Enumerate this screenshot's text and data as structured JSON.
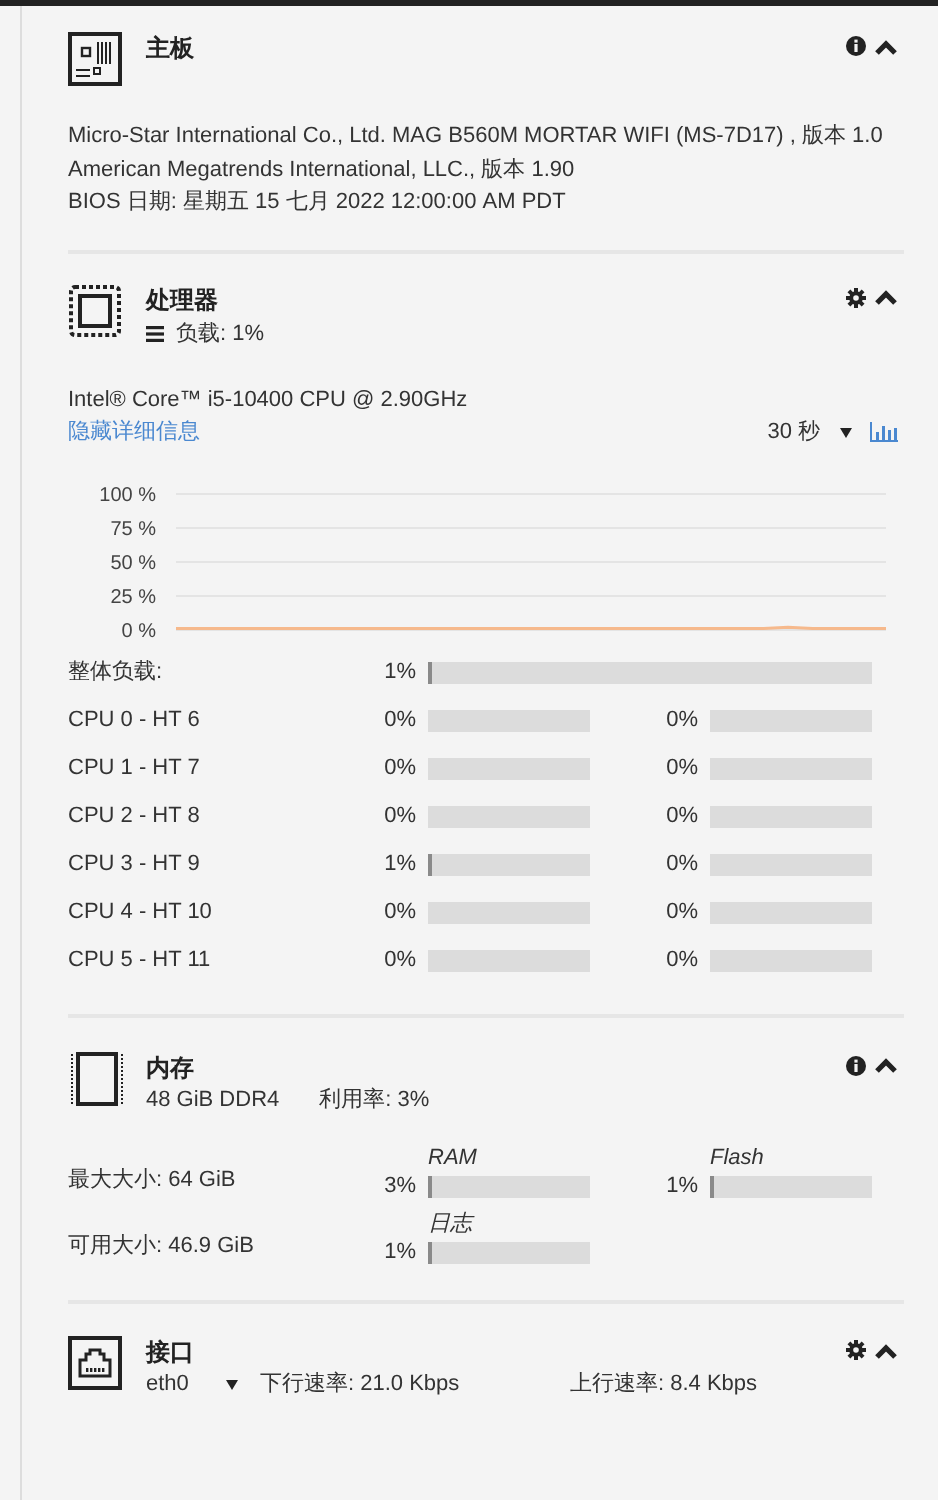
{
  "motherboard": {
    "title": "主板",
    "lines": [
      "Micro-Star International Co., Ltd. MAG B560M MORTAR WIFI (MS-7D17) , 版本 1.0",
      "American Megatrends International, LLC., 版本 1.90",
      "BIOS 日期: 星期五 15 七月 2022 12:00:00 AM PDT"
    ]
  },
  "processor": {
    "title": "处理器",
    "load": "负载: 1%",
    "model": "Intel® Core™ i5-10400 CPU @ 2.90GHz",
    "details_link": "隐藏详细信息",
    "interval": "30 秒",
    "chart_data": {
      "type": "line",
      "ylim": [
        0,
        100
      ],
      "yticks": [
        {
          "value": 100,
          "label": "100 %"
        },
        {
          "value": 75,
          "label": "75 %"
        },
        {
          "value": 50,
          "label": "50 %"
        },
        {
          "value": 25,
          "label": "25 %"
        },
        {
          "value": 0,
          "label": "0 %"
        }
      ],
      "grid": true,
      "series": [
        {
          "color": "#f6b98c",
          "values": [
            1,
            1,
            1,
            1,
            1,
            1,
            1,
            1,
            1,
            1,
            1,
            1,
            1,
            1,
            1,
            1,
            1,
            1,
            1,
            1,
            1,
            1,
            1,
            1,
            1,
            2,
            1,
            1,
            1,
            1
          ]
        }
      ]
    },
    "overall": {
      "label": "整体负载:",
      "reading": "1%",
      "level": 0.01
    },
    "cores": [
      {
        "label": "CPU 0 - HT 6",
        "bars": [
          {
            "reading": "0%",
            "level": 0
          },
          {
            "reading": "0%",
            "level": 0
          }
        ]
      },
      {
        "label": "CPU 1 - HT 7",
        "bars": [
          {
            "reading": "0%",
            "level": 0
          },
          {
            "reading": "0%",
            "level": 0
          }
        ]
      },
      {
        "label": "CPU 2 - HT 8",
        "bars": [
          {
            "reading": "0%",
            "level": 0
          },
          {
            "reading": "0%",
            "level": 0
          }
        ]
      },
      {
        "label": "CPU 3 - HT 9",
        "bars": [
          {
            "reading": "1%",
            "level": 0.01
          },
          {
            "reading": "0%",
            "level": 0
          }
        ]
      },
      {
        "label": "CPU 4 - HT 10",
        "bars": [
          {
            "reading": "0%",
            "level": 0
          },
          {
            "reading": "0%",
            "level": 0
          }
        ]
      },
      {
        "label": "CPU 5 - HT 11",
        "bars": [
          {
            "reading": "0%",
            "level": 0
          },
          {
            "reading": "0%",
            "level": 0
          }
        ]
      }
    ]
  },
  "memory": {
    "title": "内存",
    "size": "48 GiB DDR4",
    "usage": "利用率: 3%",
    "rows": [
      {
        "label": "最大大小: 64 GiB",
        "meters": [
          {
            "name": "RAM",
            "reading": "3%",
            "level": 0.03
          },
          {
            "name": "Flash",
            "reading": "1%",
            "level": 0.01
          }
        ]
      },
      {
        "label": "可用大小: 46.9 GiB",
        "meters": [
          {
            "name": "日志",
            "reading": "1%",
            "level": 0.01
          }
        ]
      }
    ]
  },
  "network": {
    "title": "接口",
    "interface": "eth0",
    "down": "下行速率: 21.0 Kbps",
    "up": "上行速率: 8.4 Kbps"
  }
}
